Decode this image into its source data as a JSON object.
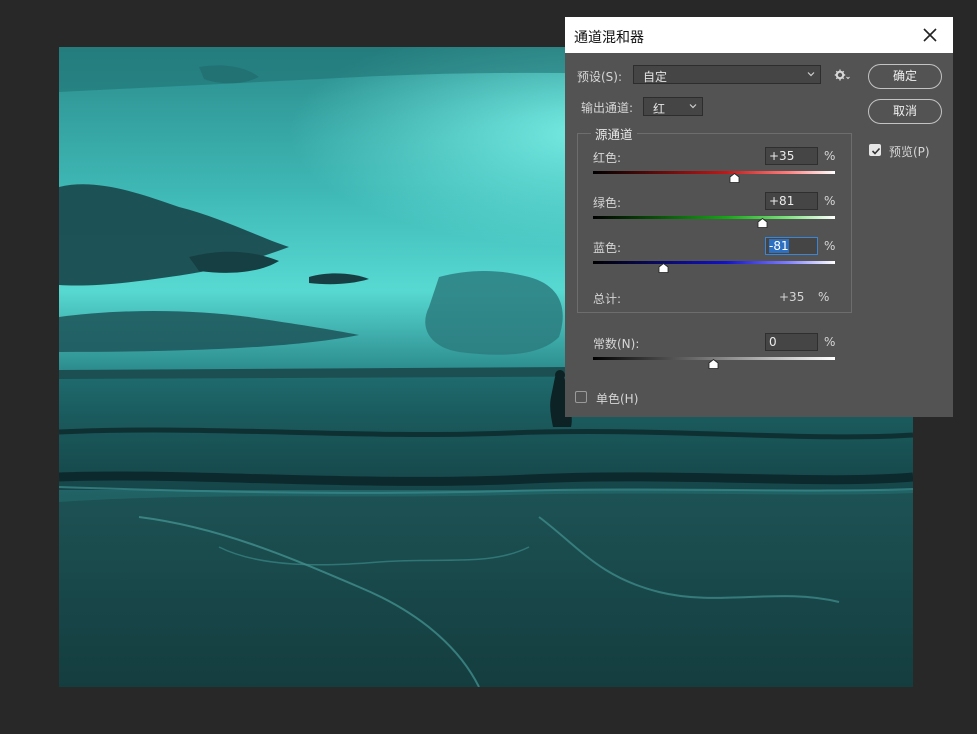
{
  "dialog": {
    "title": "通道混和器",
    "preset_label": "预设(S):",
    "preset_value": "自定",
    "output_label": "输出通道:",
    "output_value": "红",
    "ok_label": "确定",
    "cancel_label": "取消",
    "preview_label": "预览(P)",
    "preview_checked": true,
    "source_group_title": "源通道",
    "channels": [
      {
        "label": "红色:",
        "value": "+35",
        "unit": "%",
        "level": 35
      },
      {
        "label": "绿色:",
        "value": "+81",
        "unit": "%",
        "level": 81
      },
      {
        "label": "蓝色:",
        "value": "-81",
        "unit": "%",
        "level": -81
      }
    ],
    "total_label": "总计:",
    "total_value": "+35",
    "total_unit": "%",
    "constant_label": "常数(N):",
    "constant_value": "0",
    "constant_unit": "%",
    "constant_level": 0,
    "monochrome_label": "单色(H)",
    "monochrome_checked": false
  },
  "icons": {
    "close": "close-icon",
    "gear": "gear-icon",
    "chevron": "chevron-down-icon",
    "check": "checkmark-icon"
  },
  "canvas": {
    "content": "teal-tinted beach photo with person standing in water"
  }
}
